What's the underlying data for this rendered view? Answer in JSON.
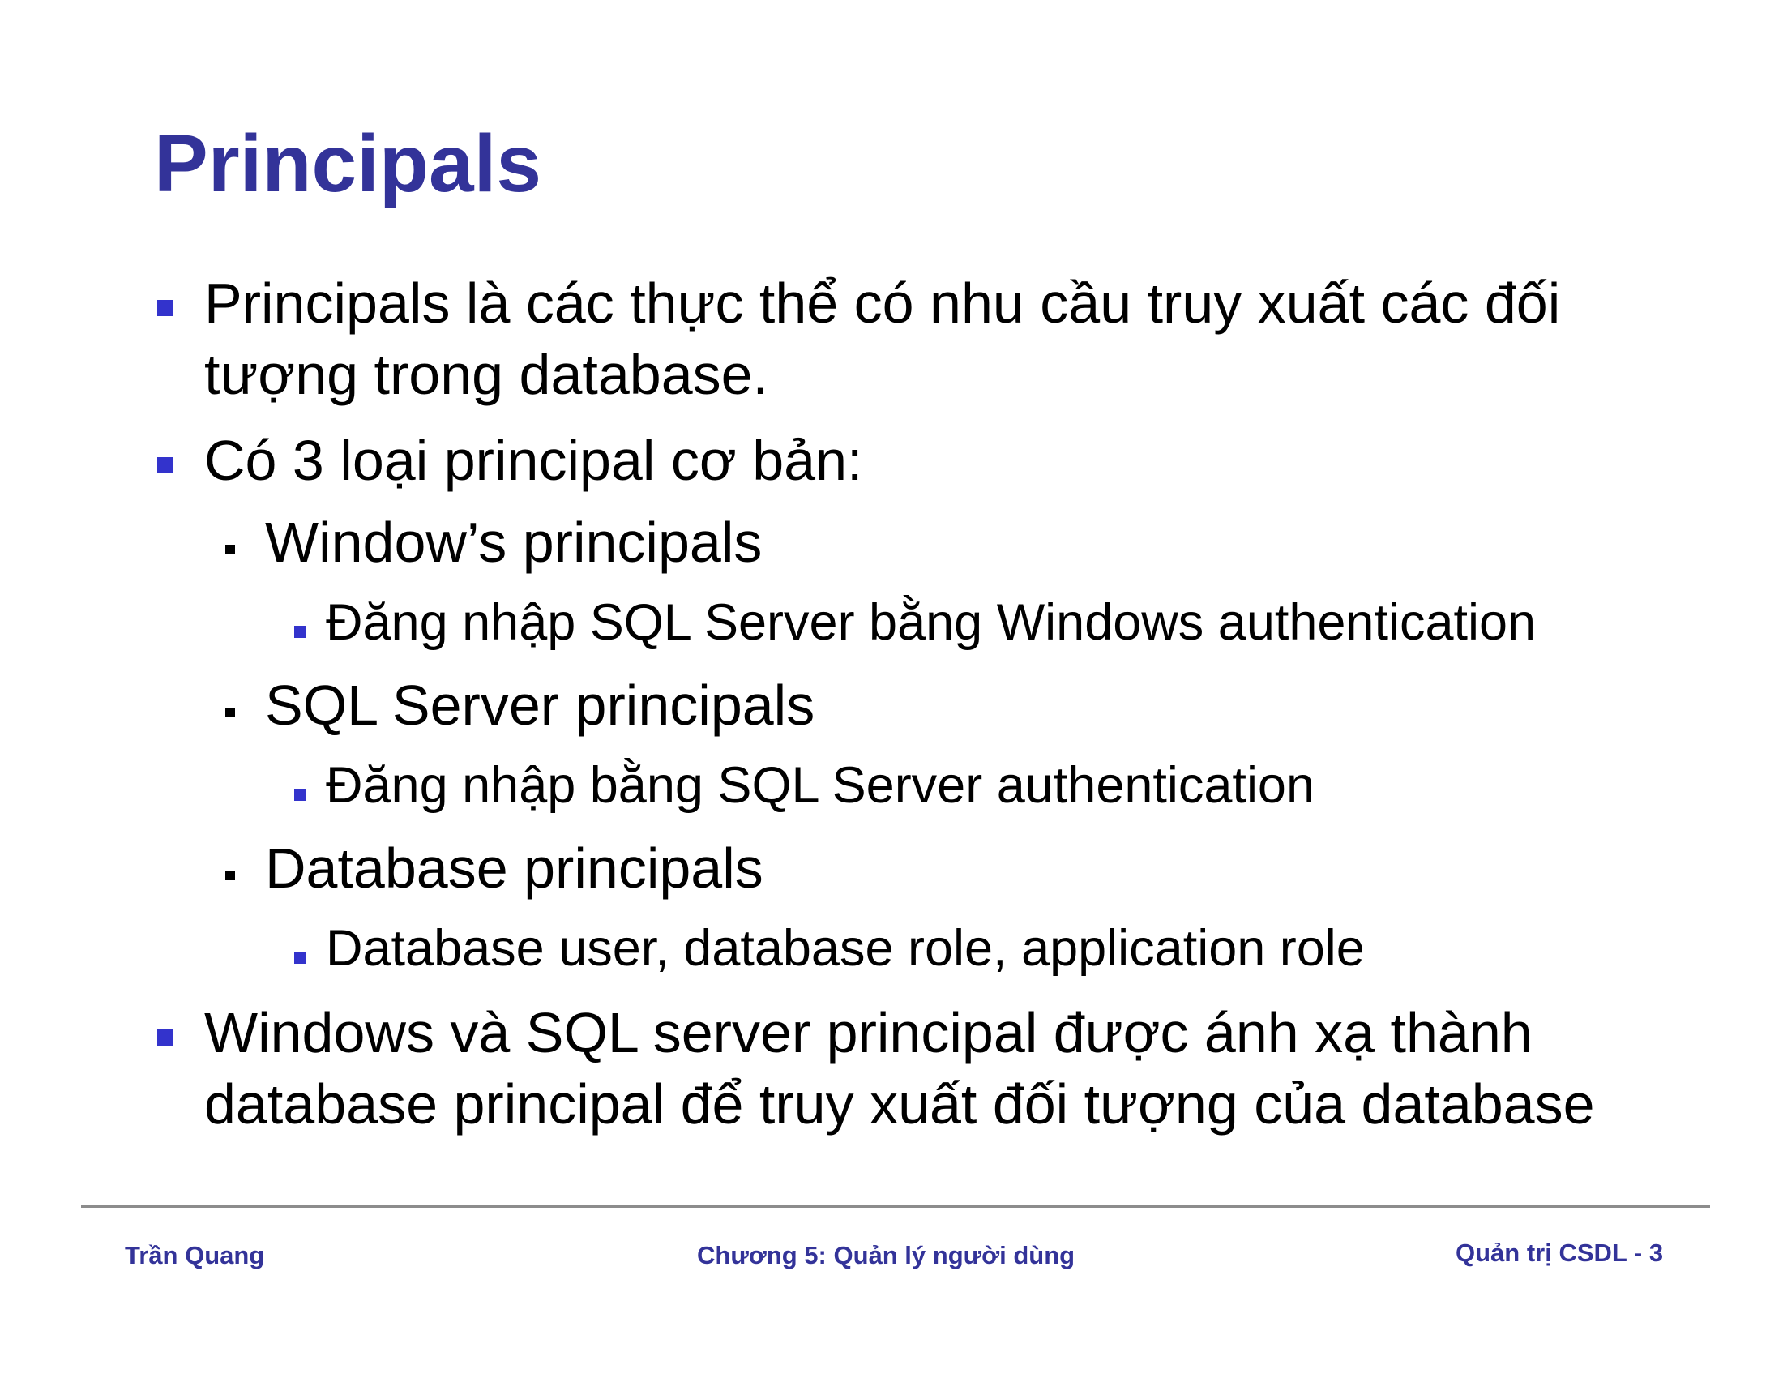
{
  "slide": {
    "title": "Principals",
    "bullets": [
      {
        "level": 1,
        "lines": [
          "Principals là các thực thể có nhu cầu truy xuất các đối",
          "tượng trong database."
        ]
      },
      {
        "level": 1,
        "lines": [
          "Có 3 loại principal cơ bản:"
        ]
      },
      {
        "level": 2,
        "lines": [
          "Window’s principals"
        ]
      },
      {
        "level": 3,
        "lines": [
          "Đăng nhập SQL Server bằng Windows authentication"
        ]
      },
      {
        "level": 2,
        "lines": [
          "SQL Server principals"
        ]
      },
      {
        "level": 3,
        "lines": [
          "Đăng nhập bằng SQL Server authentication"
        ]
      },
      {
        "level": 2,
        "lines": [
          "Database principals"
        ]
      },
      {
        "level": 3,
        "lines": [
          "Database user, database role, application role"
        ]
      },
      {
        "level": 1,
        "lines": [
          "Windows và SQL server principal được ánh xạ thành",
          "database principal để truy xuất đối tượng của database"
        ]
      }
    ]
  },
  "footer": {
    "author": "Trần Quang",
    "chapter": "Chương 5: Quản lý người dùng",
    "page": "Quản trị CSDL - 3"
  },
  "colors": {
    "title": "#333399",
    "bullet_marker": "#3333cc",
    "sub_bullet_marker": "#000000",
    "divider": "#8c8c8c"
  }
}
